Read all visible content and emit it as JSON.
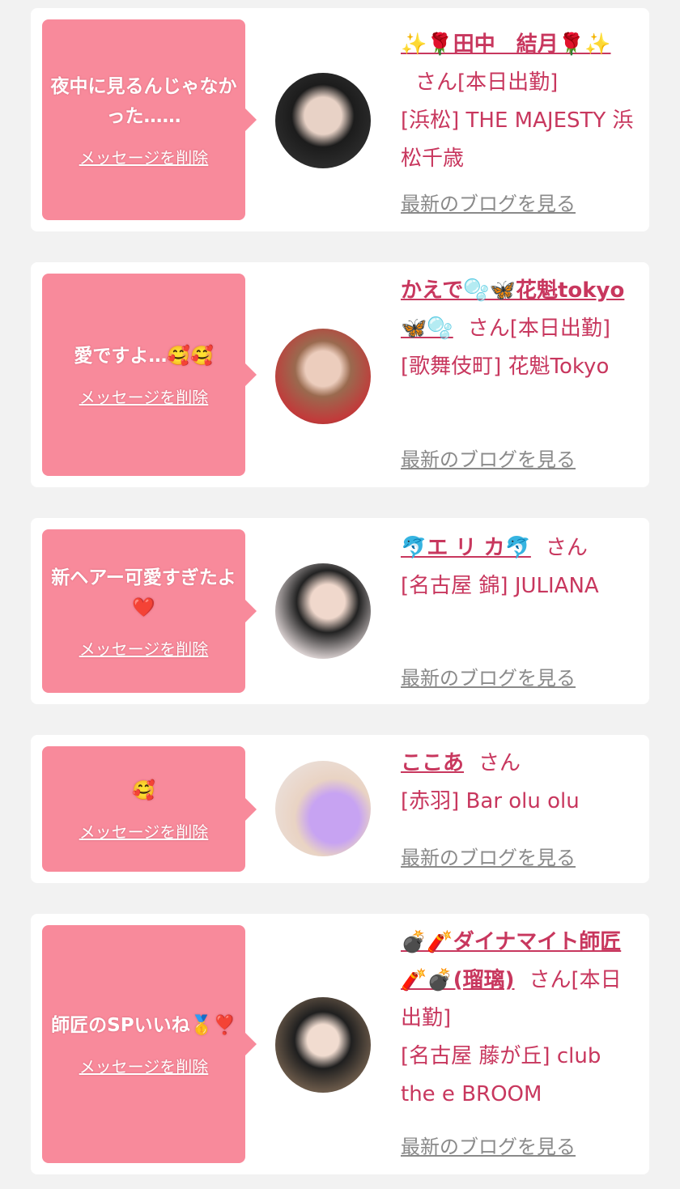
{
  "cards": [
    {
      "message": "夜中に見るんじゃなかった……",
      "delete_label": "メッセージを削除",
      "name": "✨🌹田中　結月🌹✨",
      "suffix": "さん[本日出勤]",
      "shop": "[浜松] THE MAJESTY 浜松千歳",
      "blog_label": "最新のブログを見る"
    },
    {
      "message": "愛ですよ…🥰🥰",
      "delete_label": "メッセージを削除",
      "name": "かえで🫧🦋花魁tokyo🦋🫧",
      "suffix": "さん[本日出勤]",
      "shop": "[歌舞伎町] 花魁Tokyo",
      "blog_label": "最新のブログを見る"
    },
    {
      "message": "新ヘアー可愛すぎたよ❤️",
      "delete_label": "メッセージを削除",
      "name": "🐬エ リ カ🐬",
      "suffix": "さん",
      "shop": "[名古屋 錦] JULIANA",
      "blog_label": "最新のブログを見る"
    },
    {
      "message": "🥰",
      "delete_label": "メッセージを削除",
      "name": "ここあ",
      "suffix": "さん",
      "shop": "[赤羽] Bar olu olu",
      "blog_label": "最新のブログを見る"
    },
    {
      "message": "師匠のSPいいね🥇❣️",
      "delete_label": "メッセージを削除",
      "name": "💣🧨ダイナマイト師匠🧨💣(瑠璃)",
      "suffix": "さん[本日出勤]",
      "shop": "[名古屋 藤が丘] club the e BROOM",
      "blog_label": "最新のブログを見る"
    }
  ],
  "colors": {
    "bubble": "#f88a9b",
    "name": "#c8375e",
    "link_gray": "#8a8a8a",
    "background": "#f2f2f2"
  }
}
